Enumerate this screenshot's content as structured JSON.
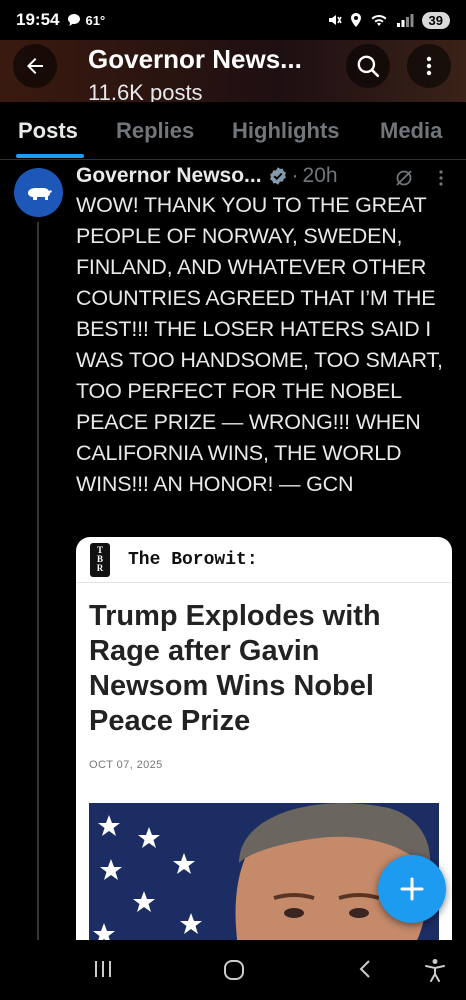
{
  "status_bar": {
    "time": "19:54",
    "weather_temp": "61°",
    "battery": "39"
  },
  "header": {
    "title": "Governor News...",
    "subtitle": "11.6K posts"
  },
  "tabs": [
    {
      "label": "Posts",
      "active": true
    },
    {
      "label": "Replies",
      "active": false
    },
    {
      "label": "Highlights",
      "active": false
    },
    {
      "label": "Media",
      "active": false
    }
  ],
  "post": {
    "author": "Governor Newso...",
    "age_separator": "·",
    "age": "20h",
    "text": "WOW! THANK YOU TO THE GREAT PEOPLE OF NORWAY, SWEDEN, FINLAND, AND WHATEVER OTHER COUNTRIES AGREED THAT I’M THE BEST!!! THE LOSER HATERS SAID I WAS TOO HANDSOME, TOO SMART, TOO PERFECT FOR THE NOBEL PEACE PRIZE — WRONG!!! WHEN CALIFORNIA WINS, THE WORLD WINS!!! AN HONOR! — GCN",
    "card": {
      "logo_letters": [
        "T",
        "B",
        "R"
      ],
      "publication": "The Borowit:",
      "headline": "Trump Explodes with Rage after Gavin Newsom Wins Nobel Peace Prize",
      "date": "OCT 07, 2025"
    }
  },
  "colors": {
    "accent": "#1d9bf0",
    "avatar_bg": "#1d57b8",
    "muted": "#71767b"
  },
  "icons": {
    "back": "arrow-left-icon",
    "search": "search-icon",
    "more": "more-vertical-icon",
    "verified": "verified-badge-icon",
    "grok": "grok-icon",
    "compose": "plus-icon"
  }
}
